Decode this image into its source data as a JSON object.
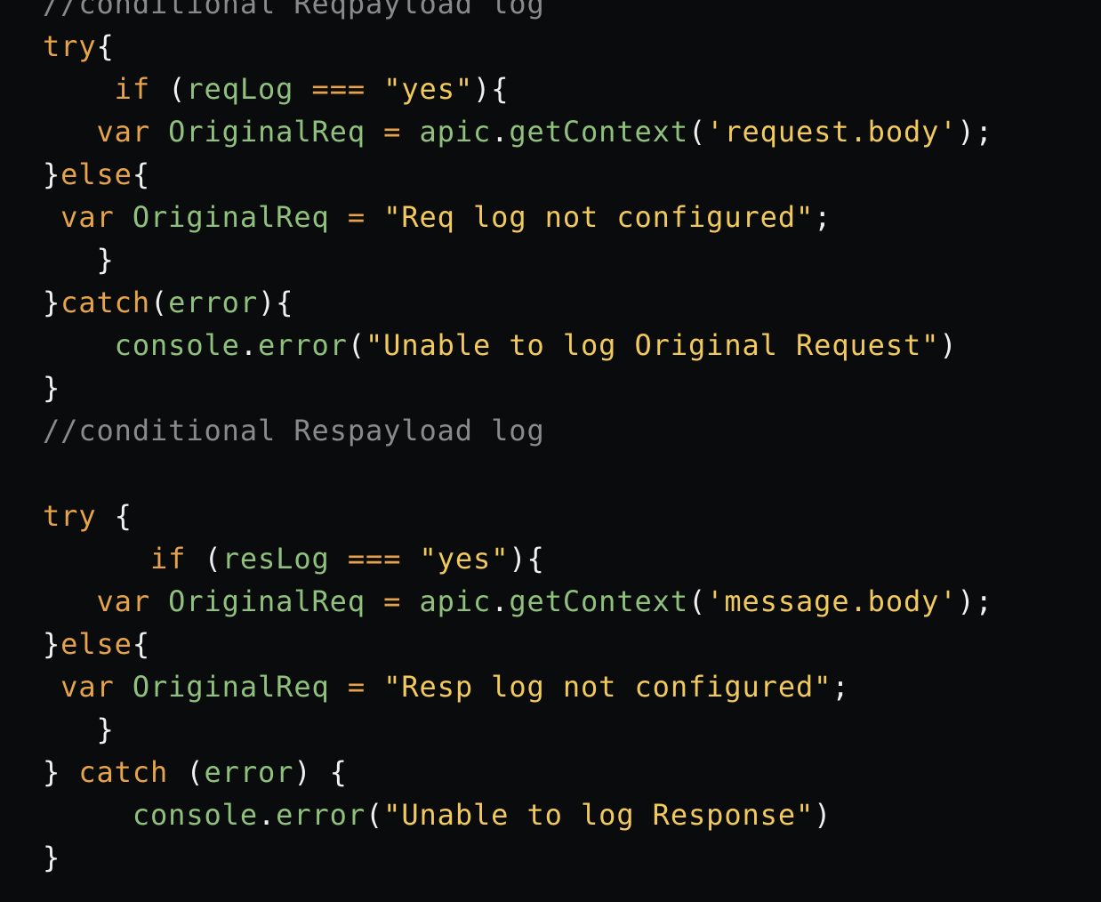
{
  "lines": [
    {
      "indent": "",
      "tokens": [
        {
          "t": "c",
          "v": "//conditional Reqpayload log"
        }
      ]
    },
    {
      "indent": "",
      "tokens": [
        {
          "t": "k",
          "v": "try"
        },
        {
          "t": "p",
          "v": "{"
        }
      ]
    },
    {
      "indent": "    ",
      "tokens": [
        {
          "t": "k",
          "v": "if"
        },
        {
          "t": "p",
          "v": " ("
        },
        {
          "t": "i",
          "v": "reqLog"
        },
        {
          "t": "p",
          "v": " "
        },
        {
          "t": "o",
          "v": "==="
        },
        {
          "t": "p",
          "v": " "
        },
        {
          "t": "s",
          "v": "\"yes\""
        },
        {
          "t": "p",
          "v": "){"
        }
      ]
    },
    {
      "indent": "   ",
      "tokens": [
        {
          "t": "k",
          "v": "var"
        },
        {
          "t": "p",
          "v": " "
        },
        {
          "t": "i",
          "v": "OriginalReq"
        },
        {
          "t": "p",
          "v": " "
        },
        {
          "t": "o",
          "v": "="
        },
        {
          "t": "p",
          "v": " "
        },
        {
          "t": "i",
          "v": "apic"
        },
        {
          "t": "p",
          "v": "."
        },
        {
          "t": "i",
          "v": "getContext"
        },
        {
          "t": "p",
          "v": "("
        },
        {
          "t": "s",
          "v": "'request.body'"
        },
        {
          "t": "p",
          "v": ");"
        }
      ]
    },
    {
      "indent": "",
      "tokens": [
        {
          "t": "p",
          "v": "}"
        },
        {
          "t": "k",
          "v": "else"
        },
        {
          "t": "p",
          "v": "{"
        }
      ]
    },
    {
      "indent": " ",
      "tokens": [
        {
          "t": "k",
          "v": "var"
        },
        {
          "t": "p",
          "v": " "
        },
        {
          "t": "i",
          "v": "OriginalReq"
        },
        {
          "t": "p",
          "v": " "
        },
        {
          "t": "o",
          "v": "="
        },
        {
          "t": "p",
          "v": " "
        },
        {
          "t": "s",
          "v": "\"Req log not configured\""
        },
        {
          "t": "p",
          "v": ";"
        }
      ]
    },
    {
      "indent": "   ",
      "tokens": [
        {
          "t": "p",
          "v": "}"
        }
      ]
    },
    {
      "indent": "",
      "tokens": [
        {
          "t": "p",
          "v": "}"
        },
        {
          "t": "k",
          "v": "catch"
        },
        {
          "t": "p",
          "v": "("
        },
        {
          "t": "i",
          "v": "error"
        },
        {
          "t": "p",
          "v": "){"
        }
      ]
    },
    {
      "indent": "    ",
      "tokens": [
        {
          "t": "i",
          "v": "console"
        },
        {
          "t": "p",
          "v": "."
        },
        {
          "t": "i",
          "v": "error"
        },
        {
          "t": "p",
          "v": "("
        },
        {
          "t": "s",
          "v": "\"Unable to log Original Request\""
        },
        {
          "t": "p",
          "v": ")"
        }
      ]
    },
    {
      "indent": "",
      "tokens": [
        {
          "t": "p",
          "v": "}"
        }
      ]
    },
    {
      "indent": "",
      "tokens": [
        {
          "t": "c",
          "v": "//conditional Respayload log"
        }
      ]
    },
    {
      "indent": "",
      "tokens": []
    },
    {
      "indent": "",
      "tokens": [
        {
          "t": "k",
          "v": "try"
        },
        {
          "t": "p",
          "v": " {"
        }
      ]
    },
    {
      "indent": "      ",
      "tokens": [
        {
          "t": "k",
          "v": "if"
        },
        {
          "t": "p",
          "v": " ("
        },
        {
          "t": "i",
          "v": "resLog"
        },
        {
          "t": "p",
          "v": " "
        },
        {
          "t": "o",
          "v": "==="
        },
        {
          "t": "p",
          "v": " "
        },
        {
          "t": "s",
          "v": "\"yes\""
        },
        {
          "t": "p",
          "v": "){"
        }
      ]
    },
    {
      "indent": "   ",
      "tokens": [
        {
          "t": "k",
          "v": "var"
        },
        {
          "t": "p",
          "v": " "
        },
        {
          "t": "i",
          "v": "OriginalReq"
        },
        {
          "t": "p",
          "v": " "
        },
        {
          "t": "o",
          "v": "="
        },
        {
          "t": "p",
          "v": " "
        },
        {
          "t": "i",
          "v": "apic"
        },
        {
          "t": "p",
          "v": "."
        },
        {
          "t": "i",
          "v": "getContext"
        },
        {
          "t": "p",
          "v": "("
        },
        {
          "t": "s",
          "v": "'message.body'"
        },
        {
          "t": "p",
          "v": ");"
        }
      ]
    },
    {
      "indent": "",
      "tokens": [
        {
          "t": "p",
          "v": "}"
        },
        {
          "t": "k",
          "v": "else"
        },
        {
          "t": "p",
          "v": "{"
        }
      ]
    },
    {
      "indent": " ",
      "tokens": [
        {
          "t": "k",
          "v": "var"
        },
        {
          "t": "p",
          "v": " "
        },
        {
          "t": "i",
          "v": "OriginalReq"
        },
        {
          "t": "p",
          "v": " "
        },
        {
          "t": "o",
          "v": "="
        },
        {
          "t": "p",
          "v": " "
        },
        {
          "t": "s",
          "v": "\"Resp log not configured\""
        },
        {
          "t": "p",
          "v": ";"
        }
      ]
    },
    {
      "indent": "   ",
      "tokens": [
        {
          "t": "p",
          "v": "}"
        }
      ]
    },
    {
      "indent": "",
      "tokens": [
        {
          "t": "p",
          "v": "} "
        },
        {
          "t": "k",
          "v": "catch"
        },
        {
          "t": "p",
          "v": " ("
        },
        {
          "t": "i",
          "v": "error"
        },
        {
          "t": "p",
          "v": ") {"
        }
      ]
    },
    {
      "indent": "     ",
      "tokens": [
        {
          "t": "i",
          "v": "console"
        },
        {
          "t": "p",
          "v": "."
        },
        {
          "t": "i",
          "v": "error"
        },
        {
          "t": "p",
          "v": "("
        },
        {
          "t": "s",
          "v": "\"Unable to log Response\""
        },
        {
          "t": "p",
          "v": ")"
        }
      ]
    },
    {
      "indent": "",
      "tokens": [
        {
          "t": "p",
          "v": "}"
        }
      ]
    }
  ]
}
